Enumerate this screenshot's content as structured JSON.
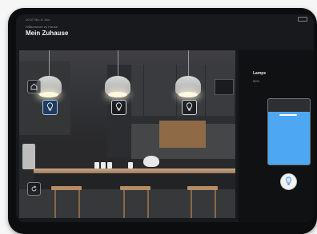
{
  "header": {
    "breadcrumb": "Willkommen zu Hause",
    "title": "Mein Zuhause"
  },
  "status": {
    "time": "10:47 Mo. 6. Jan."
  },
  "panel": {
    "title": "Lampe",
    "subtitle": "80%",
    "close_label": "×",
    "brightness": 0.8
  },
  "pager": {
    "count": 3,
    "active_index": 1
  },
  "icons": {
    "home": "home-icon",
    "lamp": "lightbulb-icon",
    "rotate": "rotate-icon",
    "close": "close-icon"
  },
  "colors": {
    "accent": "#2b8de1",
    "slider": "#4da7f2"
  }
}
